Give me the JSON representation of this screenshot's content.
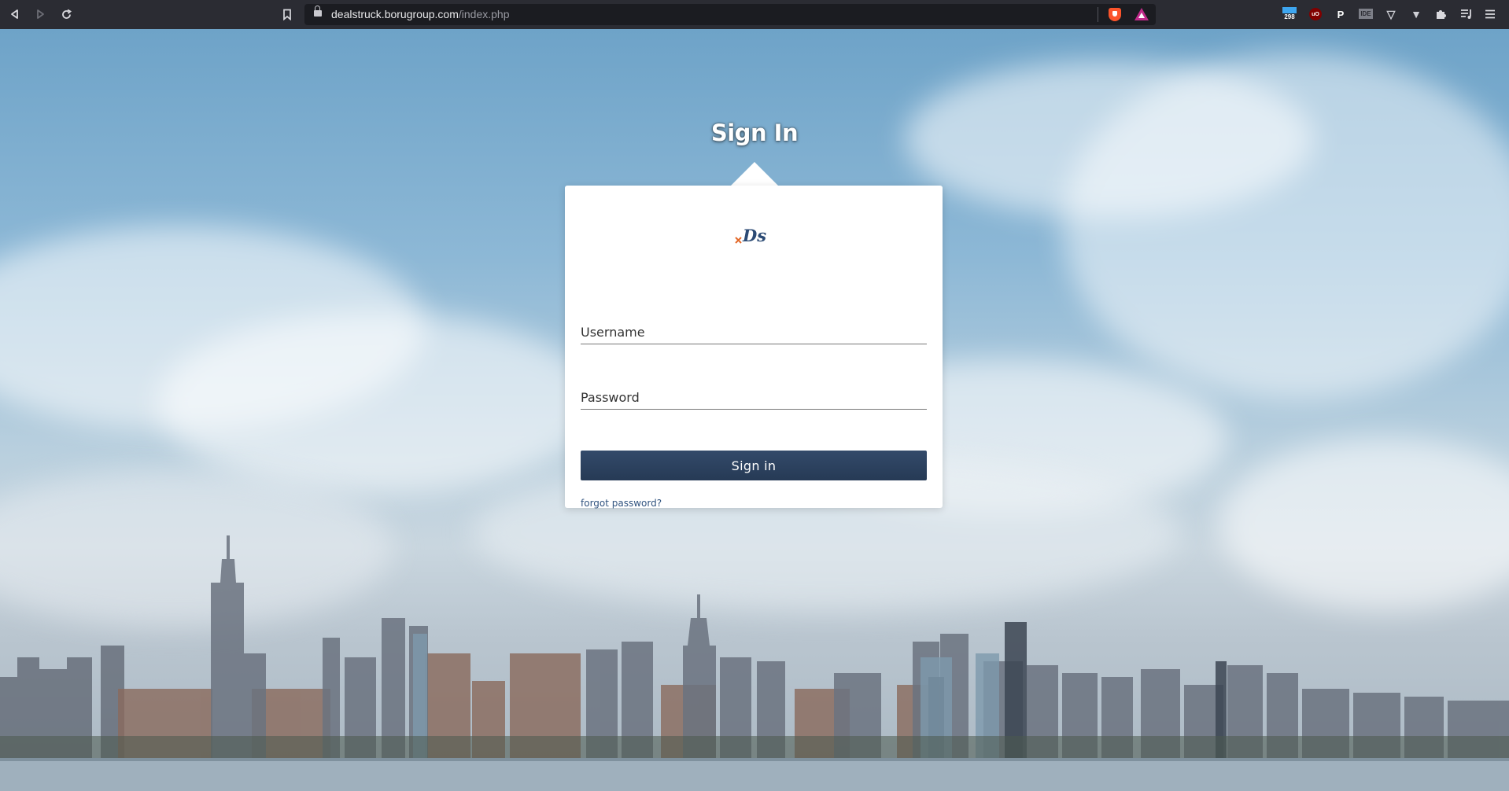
{
  "browser": {
    "url_host": "dealstruck.borugroup.com",
    "url_path": "/index.php",
    "icons": [
      "back-icon",
      "forward-icon",
      "reload-icon",
      "bookmark-icon",
      "lock-icon",
      "brave-shields-icon",
      "brave-rewards-icon"
    ],
    "extensions": {
      "counter_badge": "298",
      "ublock_label": "uO",
      "p_label": "P",
      "ide_label": "IDE"
    }
  },
  "login": {
    "title": "Sign In",
    "logo_text": "Ds",
    "username_placeholder": "Username",
    "password_placeholder": "Password",
    "submit_label": "Sign in",
    "forgot_label": "forgot password?"
  },
  "colors": {
    "button": "#263a55",
    "link": "#30537f",
    "logo_blue": "#2b4a74",
    "logo_orange": "#e36b2c"
  }
}
